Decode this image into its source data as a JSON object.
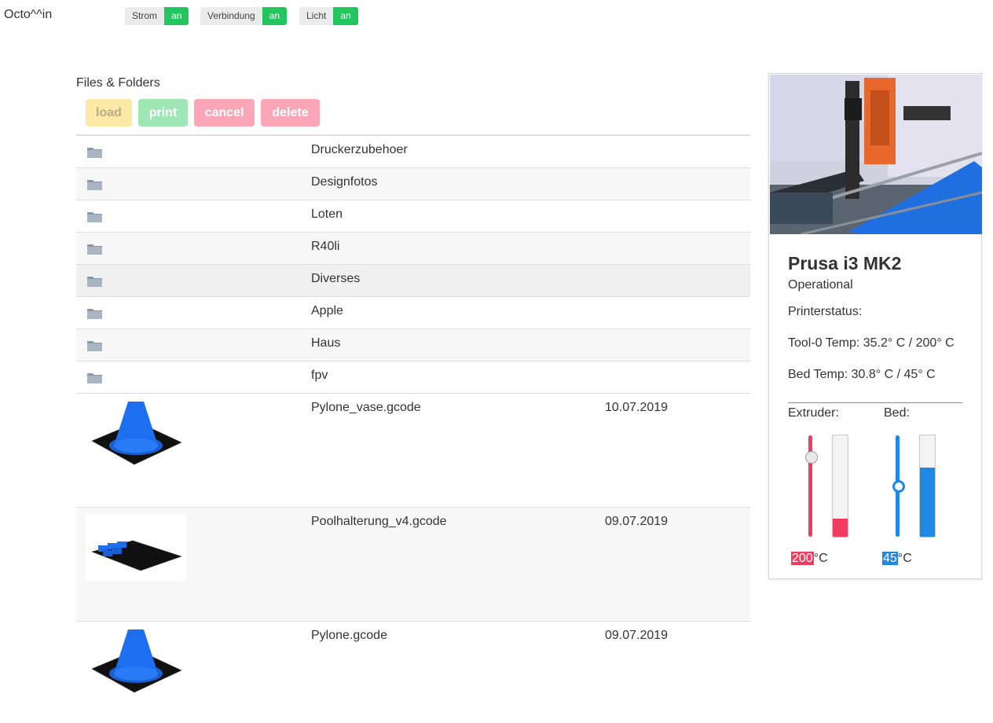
{
  "header": {
    "brand": "Octo^^in",
    "toggles": [
      {
        "label": "Strom",
        "state": "an"
      },
      {
        "label": "Verbindung",
        "state": "an"
      },
      {
        "label": "Licht",
        "state": "an"
      }
    ]
  },
  "files": {
    "title": "Files & Folders",
    "buttons": {
      "load": "load",
      "print": "print",
      "cancel": "cancel",
      "delete": "delete"
    },
    "folders": [
      "Druckerzubehoer",
      "Designfotos",
      "Loten",
      "R40li",
      "Diverses",
      "Apple",
      "Haus",
      "fpv"
    ],
    "gcode_files": [
      {
        "name": "Pylone_vase.gcode",
        "date": "10.07.2019"
      },
      {
        "name": "Poolhalterung_v4.gcode",
        "date": "09.07.2019"
      },
      {
        "name": "Pylone.gcode",
        "date": "09.07.2019"
      }
    ]
  },
  "printer": {
    "name": "Prusa i3 MK2",
    "state": "Operational",
    "status_label": "Printerstatus:",
    "tool_temp": "Tool-0 Temp: 35.2° C / 200° C",
    "bed_temp": "Bed Temp: 30.8° C / 45° C",
    "extruder_label": "Extruder:",
    "bed_label": "Bed:",
    "extruder_target": "200",
    "bed_target": "45",
    "unit": "°C",
    "extruder_gauge_fraction": 0.18,
    "bed_gauge_fraction": 0.68,
    "extruder_slider_fraction": 0.78,
    "bed_slider_fraction": 0.5
  },
  "colors": {
    "state_on": "#22c55e",
    "extruder": "#f03d5f",
    "bed": "#1e88e5",
    "load": "#fde9a6",
    "print": "#9ee6b4",
    "cancel_delete": "#fba6b6"
  }
}
